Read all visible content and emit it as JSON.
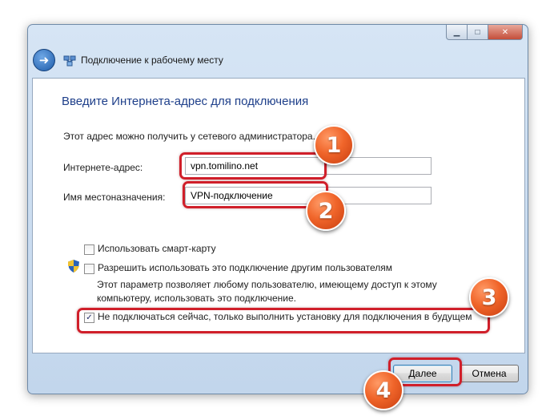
{
  "window": {
    "title": "Подключение к рабочему месту",
    "controls": {
      "minimize": "▁",
      "maximize": "□",
      "close": "✕"
    }
  },
  "icons": {
    "back": "back-arrow-icon",
    "network": "network-icon",
    "shield": "uac-shield-icon"
  },
  "page": {
    "heading": "Введите Интернета-адрес для подключения",
    "hint": "Этот адрес можно получить у сетевого администратора."
  },
  "form": {
    "address_label": "Интернете-адрес:",
    "address_value": "vpn.tomilino.net",
    "name_label": "Имя местоназначения:",
    "name_value": "VPN-подключение"
  },
  "options": {
    "smartcard": {
      "label": "Использовать смарт-карту",
      "checked": false
    },
    "allow_others": {
      "label": "Разрешить использовать это подключение другим пользователям",
      "checked": false,
      "note": "Этот параметр позволяет любому пользователю, имеющему доступ к этому компьютеру, использовать это подключение."
    },
    "dont_connect": {
      "label": "Не подключаться сейчас, только выполнить установку для подключения в будущем",
      "checked": true,
      "check_glyph": "✓"
    }
  },
  "buttons": {
    "next": "Далее",
    "cancel": "Отмена"
  },
  "annotations": [
    "1",
    "2",
    "3",
    "4"
  ],
  "colors": {
    "highlight": "#d01f2a",
    "badge": "#f0652a",
    "heading": "#1e3f8a"
  }
}
